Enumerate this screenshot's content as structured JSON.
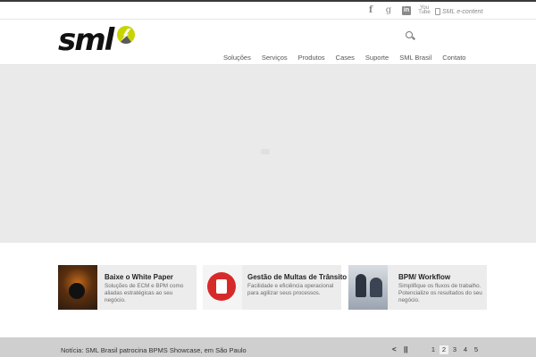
{
  "topbar": {
    "social": [
      {
        "name": "facebook-icon",
        "glyph": "f"
      },
      {
        "name": "google-plus-icon",
        "glyph": "g"
      },
      {
        "name": "linkedin-icon",
        "glyph": "in"
      },
      {
        "name": "youtube-icon",
        "glyph": "You Tube"
      }
    ],
    "ecm_link": "SML e-content"
  },
  "header": {
    "logo_text": "sml",
    "nav": [
      "Soluções",
      "Serviços",
      "Produtos",
      "Cases",
      "Suporte",
      "SML Brasil",
      "Contato"
    ]
  },
  "promos": [
    {
      "title": "Baixe o White Paper",
      "desc": "Soluções de ECM e BPM como aliadas estratégicas ao seu negócio."
    },
    {
      "title": "Gestão de Multas de Trânsito",
      "desc": "Facilidade e eficiência operacional para agilizar seus processos."
    },
    {
      "title": "BPM/ Workflow",
      "desc": "Simplifique os fluxos de trabalho. Potencialize os resultados do seu negócio."
    }
  ],
  "footer": {
    "news": "Notícia: SML Brasil patrocina BPMS Showcase, em São Paulo",
    "prev": "<",
    "pause": "||",
    "pages": [
      "1",
      "2",
      "3",
      "4",
      "5"
    ],
    "active_page": "2"
  },
  "colors": {
    "accent": "#c8d400",
    "footer_bg": "#cfcfcf",
    "slider_bg": "#eaeaea"
  }
}
